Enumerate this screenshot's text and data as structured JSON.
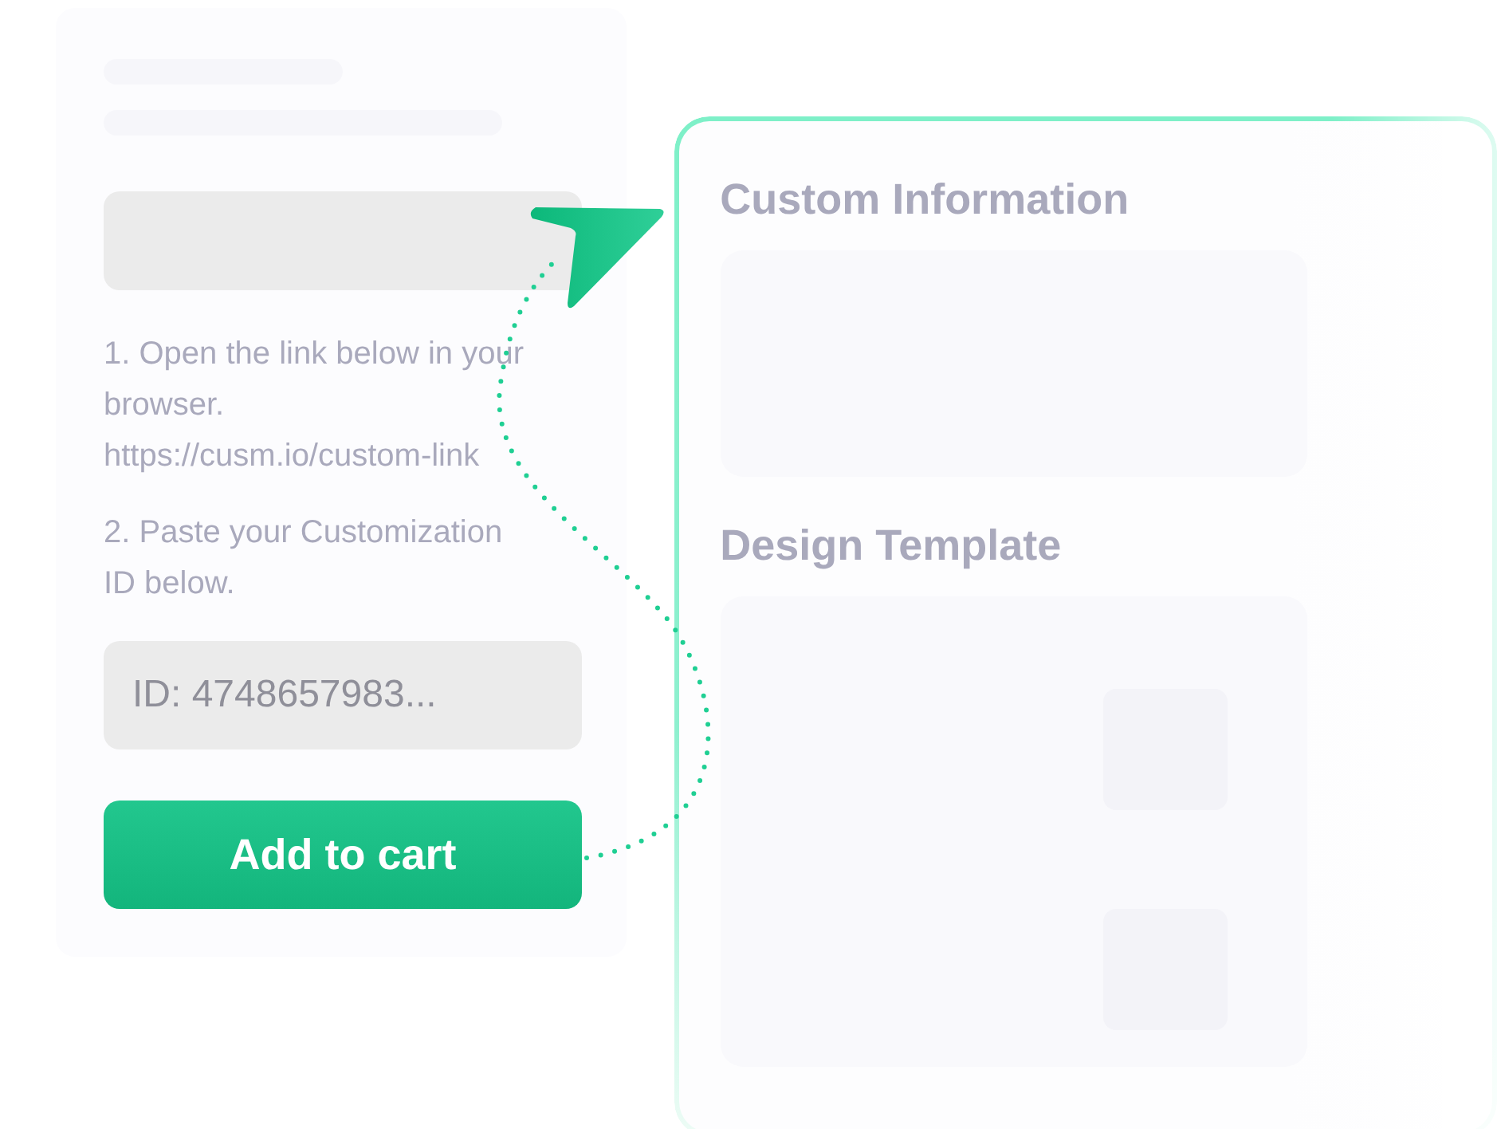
{
  "left_card": {
    "step_1": "1. Open the link below in your browser.",
    "link": "https://cusm.io/custom-link",
    "step_2": "2. Paste your Customization ID below.",
    "id_field": {
      "value": "ID: 4748657983..."
    },
    "add_button": "Add to cart"
  },
  "right_panel": {
    "sections": [
      {
        "title": "Custom Information",
        "kind": "info"
      },
      {
        "title": "Design Template",
        "kind": "template"
      }
    ]
  }
}
